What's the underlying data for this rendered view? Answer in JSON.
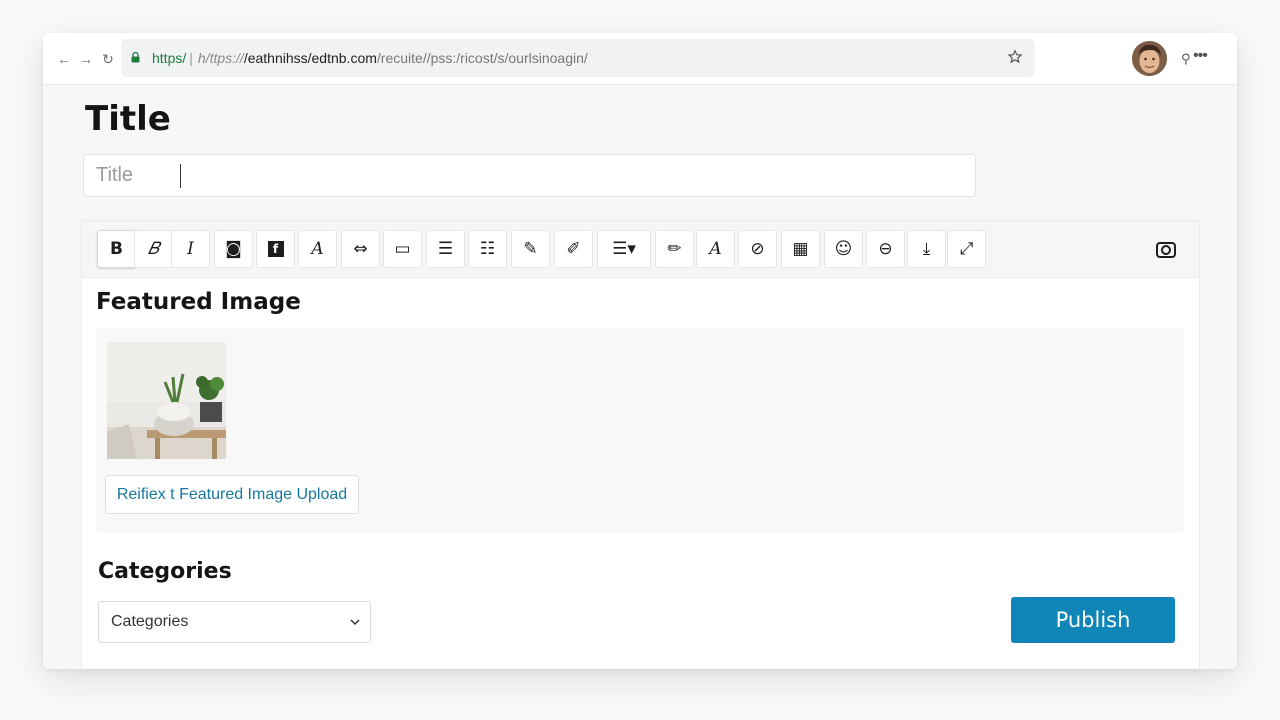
{
  "browser": {
    "url_scheme": "https",
    "url_scheme_sep": "/",
    "url_divider": "|",
    "url_prefix": "h/ttps://",
    "url_host": "/eathnihss/edtnb.com",
    "url_path": "/recuite//pss:/ricost/s/ourlsinoagin/"
  },
  "editor": {
    "page_title": "Title",
    "title_placeholder": "Title",
    "toolbar_icons": [
      "bold-icon",
      "italic-outline-icon",
      "italic-icon",
      "embed-icon",
      "facebook-icon",
      "script-icon",
      "strike-icon",
      "card-icon",
      "list-icon",
      "checklist-icon",
      "highlight-icon",
      "marker-icon",
      "list-dropdown-icon",
      "pen-icon",
      "script-alt-icon",
      "link-icon",
      "table-icon",
      "emoji-icon",
      "clear-icon",
      "download-icon",
      "expand-icon"
    ],
    "toolbar_labels": {
      "bold": "B",
      "italic_outline": "𝐵",
      "italic": "I",
      "embed": "◙",
      "box_f": "f",
      "script": "A",
      "strike": "⇔",
      "card": "▭",
      "list": "☰",
      "checklist": "☷",
      "highlight": "✎",
      "marker": "✐",
      "list_dropdown": "☰▾",
      "pen": "✏",
      "script_alt": "A",
      "link": "⊘",
      "table": "▦",
      "emoji": "☺",
      "clear": "⊖",
      "download": "⤓",
      "expand": "⤢"
    },
    "featured_heading": "Featured Image",
    "upload_label": "Reifiex t Featured Image Upload",
    "categories_heading": "Categories",
    "categories_selected": "Categories",
    "publish_label": "Publish"
  },
  "colors": {
    "accent": "#0f86b7",
    "link": "#17779f",
    "secure": "#1b7f3a"
  }
}
